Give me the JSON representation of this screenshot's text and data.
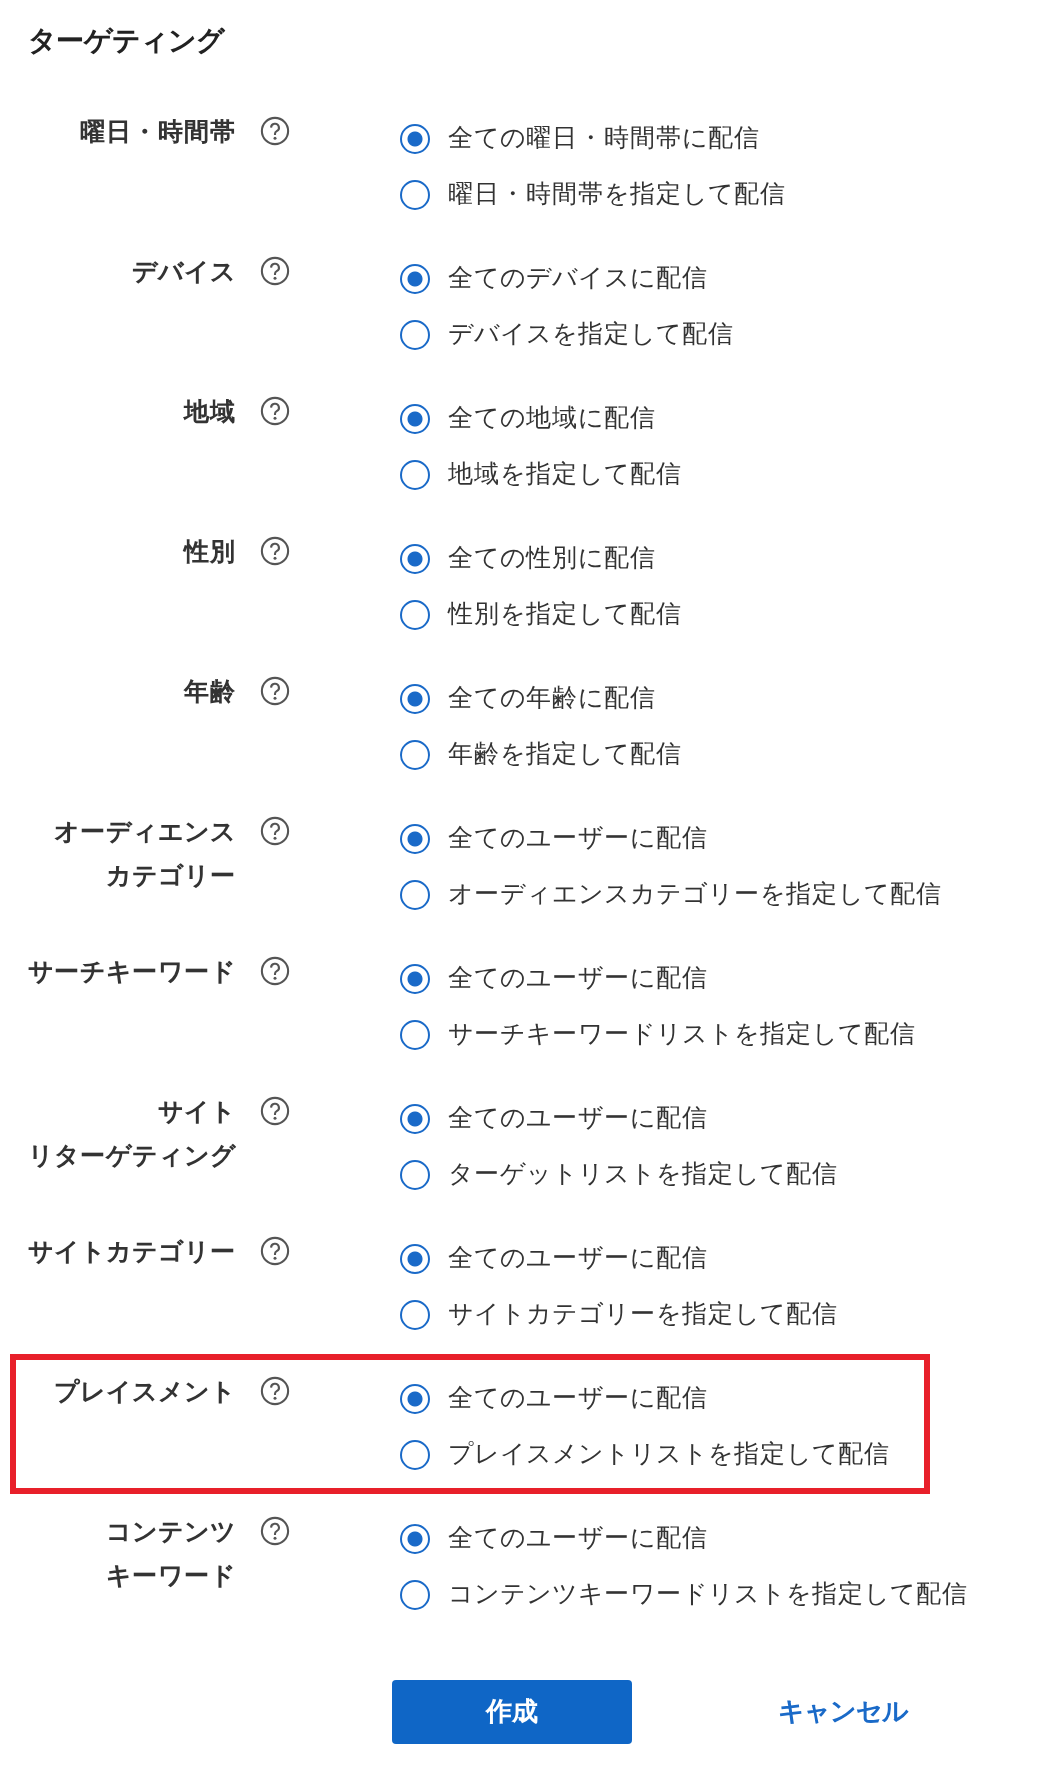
{
  "title": "ターゲティング",
  "rows": [
    {
      "label": [
        "曜日・時間帯"
      ],
      "highlighted": false,
      "options": [
        {
          "text": "全ての曜日・時間帯に配信",
          "selected": true
        },
        {
          "text": "曜日・時間帯を指定して配信",
          "selected": false
        }
      ]
    },
    {
      "label": [
        "デバイス"
      ],
      "highlighted": false,
      "options": [
        {
          "text": "全てのデバイスに配信",
          "selected": true
        },
        {
          "text": "デバイスを指定して配信",
          "selected": false
        }
      ]
    },
    {
      "label": [
        "地域"
      ],
      "highlighted": false,
      "options": [
        {
          "text": "全ての地域に配信",
          "selected": true
        },
        {
          "text": "地域を指定して配信",
          "selected": false
        }
      ]
    },
    {
      "label": [
        "性別"
      ],
      "highlighted": false,
      "options": [
        {
          "text": "全ての性別に配信",
          "selected": true
        },
        {
          "text": "性別を指定して配信",
          "selected": false
        }
      ]
    },
    {
      "label": [
        "年齢"
      ],
      "highlighted": false,
      "options": [
        {
          "text": "全ての年齢に配信",
          "selected": true
        },
        {
          "text": "年齢を指定して配信",
          "selected": false
        }
      ]
    },
    {
      "label": [
        "オーディエンス",
        "カテゴリー"
      ],
      "highlighted": false,
      "options": [
        {
          "text": "全てのユーザーに配信",
          "selected": true
        },
        {
          "text": "オーディエンスカテゴリーを指定して配信",
          "selected": false
        }
      ]
    },
    {
      "label": [
        "サーチキーワード"
      ],
      "highlighted": false,
      "options": [
        {
          "text": "全てのユーザーに配信",
          "selected": true
        },
        {
          "text": "サーチキーワードリストを指定して配信",
          "selected": false
        }
      ]
    },
    {
      "label": [
        "サイト",
        "リターゲティング"
      ],
      "highlighted": false,
      "options": [
        {
          "text": "全てのユーザーに配信",
          "selected": true
        },
        {
          "text": "ターゲットリストを指定して配信",
          "selected": false
        }
      ]
    },
    {
      "label": [
        "サイトカテゴリー"
      ],
      "highlighted": false,
      "options": [
        {
          "text": "全てのユーザーに配信",
          "selected": true
        },
        {
          "text": "サイトカテゴリーを指定して配信",
          "selected": false
        }
      ]
    },
    {
      "label": [
        "プレイスメント"
      ],
      "highlighted": true,
      "options": [
        {
          "text": "全てのユーザーに配信",
          "selected": true
        },
        {
          "text": "プレイスメントリストを指定して配信",
          "selected": false
        }
      ]
    },
    {
      "label": [
        "コンテンツ",
        "キーワード"
      ],
      "highlighted": false,
      "options": [
        {
          "text": "全てのユーザーに配信",
          "selected": true
        },
        {
          "text": "コンテンツキーワードリストを指定して配信",
          "selected": false
        }
      ]
    }
  ],
  "buttons": {
    "primary": "作成",
    "cancel": "キャンセル"
  }
}
